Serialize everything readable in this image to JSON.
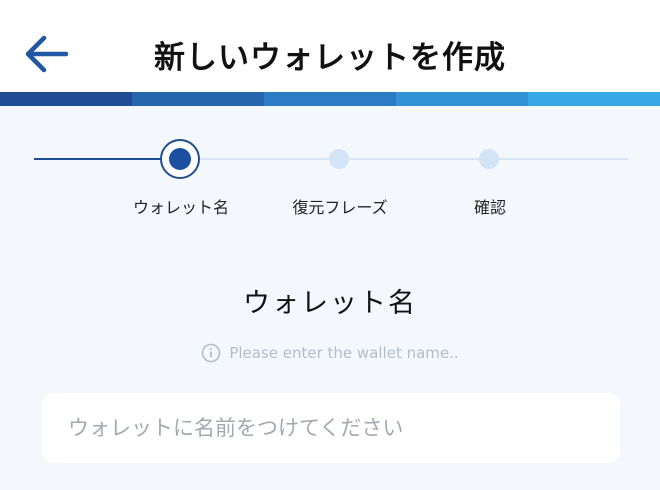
{
  "header": {
    "title": "新しいウォレットを作成",
    "back_icon": "arrow-left-icon"
  },
  "colors": {
    "primary": "#1c4fa0",
    "band": [
      "#1f4c93",
      "#2566ad",
      "#2b7cc4",
      "#3192d6",
      "#37a8e6"
    ],
    "inactive_step": "#d4e4f7",
    "placeholder": "#a4a9b1"
  },
  "stepper": {
    "current_step": 1,
    "steps": [
      {
        "label": "ウォレット名"
      },
      {
        "label": "復元フレーズ"
      },
      {
        "label": "確認"
      }
    ]
  },
  "section": {
    "title": "ウォレット名",
    "hint": "Please enter the wallet name..",
    "hint_icon": "info-icon"
  },
  "wallet_name_input": {
    "value": "",
    "placeholder": "ウォレットに名前をつけてください"
  }
}
